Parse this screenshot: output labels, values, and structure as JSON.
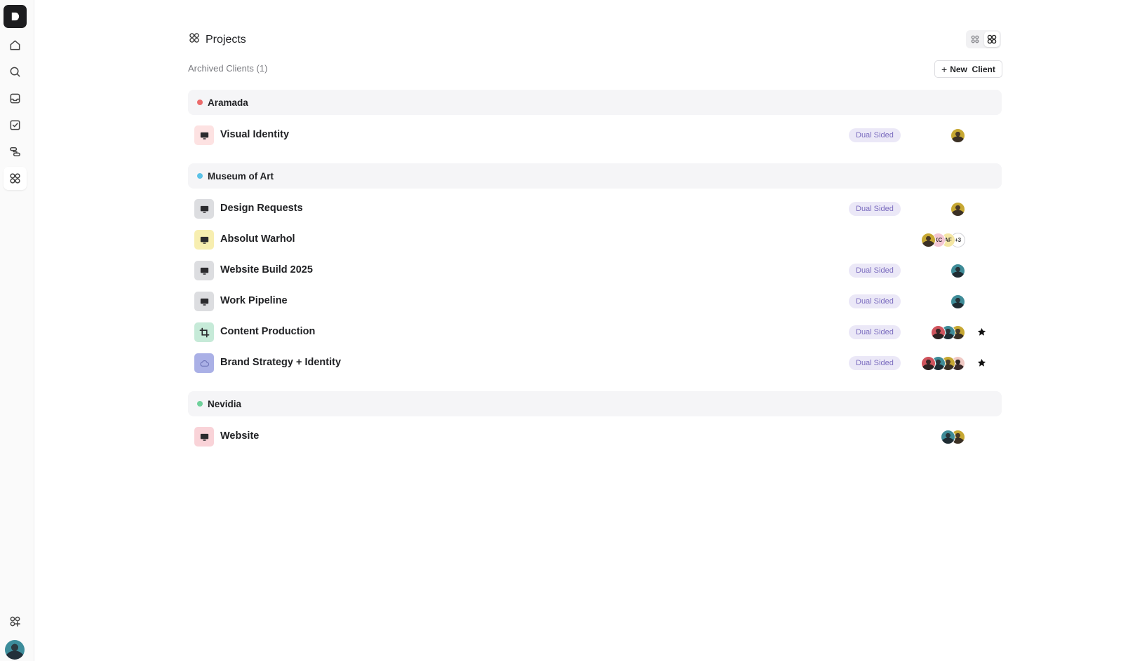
{
  "app": {
    "logo_letter": "D"
  },
  "sidebar": {
    "items": [
      {
        "icon": "home-icon",
        "active": false
      },
      {
        "icon": "search-icon",
        "active": false
      },
      {
        "icon": "inbox-icon",
        "active": false
      },
      {
        "icon": "tasks-icon",
        "active": false
      },
      {
        "icon": "workflow-icon",
        "active": false
      },
      {
        "icon": "projects-icon",
        "active": true
      }
    ],
    "bottom": [
      {
        "icon": "add-app-icon"
      },
      {
        "icon": "user-avatar"
      }
    ]
  },
  "header": {
    "title": "Projects",
    "archived_label": "Archived Clients (1)",
    "new_client_label": "New  Client"
  },
  "colors": {
    "badge_bg": "#ebe8f7",
    "badge_text": "#7b6cbf"
  },
  "groups": [
    {
      "name": "Aramada",
      "dot_color": "#ec6b6b",
      "projects": [
        {
          "name": "Visual Identity",
          "badge": "Dual Sided",
          "icon_bg": "#fde2e2",
          "icon": "monitor-icon",
          "avatars": [
            "gold"
          ],
          "starred": false
        }
      ]
    },
    {
      "name": "Museum of Art",
      "dot_color": "#5bc2e7",
      "projects": [
        {
          "name": "Design Requests",
          "badge": "Dual Sided",
          "icon_bg": "#dcdde0",
          "icon": "monitor-icon",
          "avatars": [
            "gold"
          ],
          "starred": false
        },
        {
          "name": "Absolut Warhol",
          "badge": "",
          "icon_bg": "#f7eeb0",
          "icon": "monitor-icon",
          "avatars": [
            "gold",
            "KC",
            "AF",
            "+3"
          ],
          "starred": false
        },
        {
          "name": "Website Build 2025",
          "badge": "Dual Sided",
          "icon_bg": "#dcdde0",
          "icon": "monitor-icon",
          "avatars": [
            "teal"
          ],
          "starred": false
        },
        {
          "name": "Work Pipeline",
          "badge": "Dual Sided",
          "icon_bg": "#dcdde0",
          "icon": "monitor-icon",
          "avatars": [
            "teal"
          ],
          "starred": false
        },
        {
          "name": "Content Production",
          "badge": "Dual Sided",
          "icon_bg": "#c6ead8",
          "icon": "crop-icon",
          "avatars": [
            "red",
            "teal",
            "gold"
          ],
          "starred": true
        },
        {
          "name": "Brand Strategy + Identity",
          "badge": "Dual Sided",
          "icon_bg": "#aab0e6",
          "icon": "cloud-icon",
          "avatars": [
            "red",
            "teal",
            "gold",
            "pinkphoto"
          ],
          "starred": true
        }
      ]
    },
    {
      "name": "Nevidia",
      "dot_color": "#6fd19b",
      "projects": [
        {
          "name": "Website",
          "badge": "",
          "icon_bg": "#f9d3d8",
          "icon": "monitor-icon",
          "avatars": [
            "teal",
            "gold"
          ],
          "starred": false
        }
      ]
    }
  ]
}
